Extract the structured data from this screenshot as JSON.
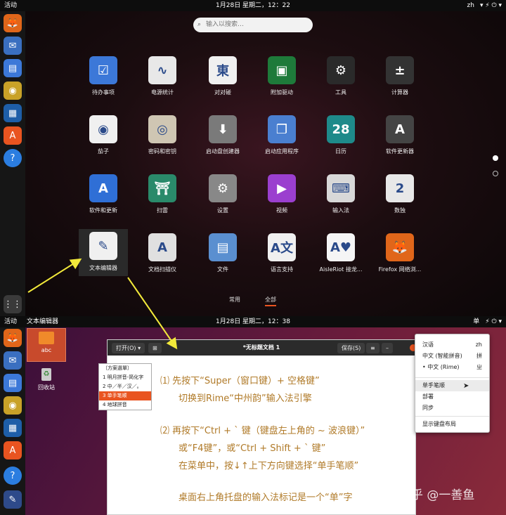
{
  "top_screen": {
    "panel": {
      "activities": "活动",
      "clock": "1月28日 星期二，12：22",
      "lang": "zh",
      "sys": "▾ ⚡ ⏻ ▾"
    },
    "search_placeholder": "输入以搜索…",
    "apps": [
      {
        "label": "待办事项",
        "glyph": "☑",
        "color": "#3c78d8"
      },
      {
        "label": "电源统计",
        "glyph": "∿",
        "color": "#e8e8e8"
      },
      {
        "label": "对对碰",
        "glyph": "東",
        "color": "#f0f0f0"
      },
      {
        "label": "附加驱动",
        "glyph": "▣",
        "color": "#1e7a3a"
      },
      {
        "label": "工具",
        "glyph": "⚙",
        "color": "#2a2a2a"
      },
      {
        "label": "计算器",
        "glyph": "±",
        "color": "#333"
      },
      {
        "label": "茄子",
        "glyph": "◉",
        "color": "#f0f0f0"
      },
      {
        "label": "密码和密钥",
        "glyph": "◎",
        "color": "#cfc6b3"
      },
      {
        "label": "启动盘创建器",
        "glyph": "⬇",
        "color": "#7a7a7a"
      },
      {
        "label": "启动应用程序",
        "glyph": "❐",
        "color": "#4a7fd0"
      },
      {
        "label": "日历",
        "glyph": "28",
        "color": "#1e8a8a"
      },
      {
        "label": "软件更新器",
        "glyph": "A",
        "color": "#444"
      },
      {
        "label": "软件和更新",
        "glyph": "A",
        "color": "#2f6fd6"
      },
      {
        "label": "扫雷",
        "glyph": "⛩",
        "color": "#2a8a6a"
      },
      {
        "label": "设置",
        "glyph": "⚙",
        "color": "#888"
      },
      {
        "label": "视频",
        "glyph": "▶",
        "color": "#9b3fcf"
      },
      {
        "label": "输入法",
        "glyph": "⌨",
        "color": "#d8d8d8"
      },
      {
        "label": "数独",
        "glyph": "2",
        "color": "#e8e8e8"
      },
      {
        "label": "文本编辑器",
        "glyph": "✎",
        "color": "#f0f0f0"
      },
      {
        "label": "文档扫描仪",
        "glyph": "A",
        "color": "#e0e0e0"
      },
      {
        "label": "文件",
        "glyph": "▤",
        "color": "#5a8fd0"
      },
      {
        "label": "语言支持",
        "glyph": "A文",
        "color": "#f0f0f0"
      },
      {
        "label": "AisleRiot 接龙...",
        "glyph": "A♥",
        "color": "#f5f5f5"
      },
      {
        "label": "Firefox 网络浏...",
        "glyph": "🦊",
        "color": "#e0661a"
      }
    ],
    "tabs": {
      "frequent": "常用",
      "all": "全部"
    }
  },
  "bottom_screen": {
    "panel": {
      "activities": "活动",
      "app_name": "文本编辑器",
      "clock": "1月28日 星期二，12：38",
      "ime": "单",
      "sys": "⚡ ⏻ ▾"
    },
    "desktop": {
      "folder": "abc",
      "trash": "回收站"
    },
    "editor": {
      "open": "打开(O)",
      "title": "*无标题文档 1",
      "save": "保存(S)"
    },
    "rime_menu": [
      "〔方案選單〕",
      "1 明月拼音-简化字",
      "2 中／半／汉／。",
      "3 单手笔顺",
      "4 地球拼音"
    ],
    "ime_menu": {
      "items": [
        {
          "label": "汉语",
          "key": "zh"
        },
        {
          "label": "中文 (智能拼音)",
          "key": "拼"
        },
        {
          "label": "• 中文 (Rime)",
          "key": "ㄓ"
        }
      ],
      "actions": [
        "单手笔顺",
        "部署",
        "同步"
      ],
      "layout": "显示键盘布局"
    },
    "notes": {
      "l1": "⑴ 先按下“Super（窗口键）+ 空格键”",
      "l2": "切换到Rime“中州韵”输入法引擎",
      "l3": "⑵ 再按下“Ctrl + ` 键（键盘左上角的 ~ 波浪键）”",
      "l4": "或“F4键”，或“Ctrl + Shift + ` 键”",
      "l5": "在菜单中，按↓↑上下方向键选择“单手笔顺”",
      "l6": "桌面右上角托盘的输入法标记是一个“单”字"
    },
    "watermark": "知乎 @一善鱼"
  },
  "accent": {
    "annotation": "#f2e93a",
    "ime_selected": "#e95420"
  }
}
